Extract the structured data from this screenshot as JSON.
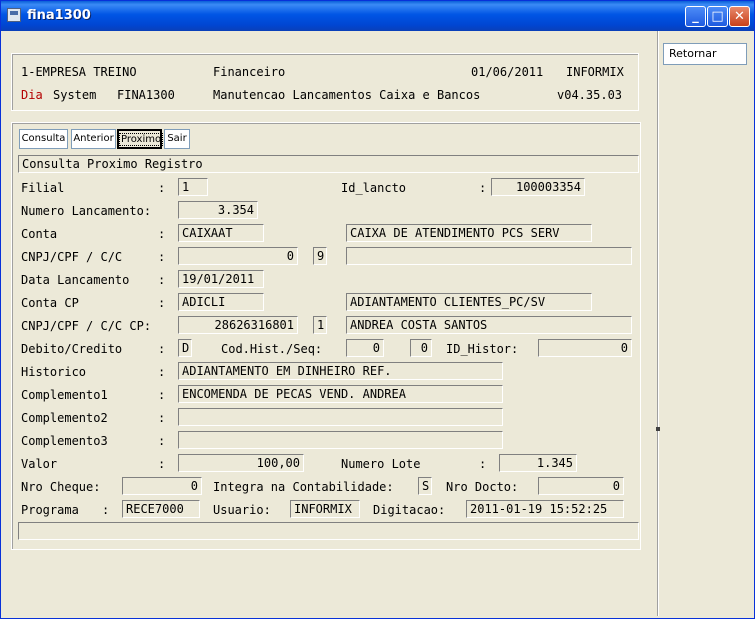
{
  "window": {
    "title": "fina1300"
  },
  "header": {
    "company": "1-EMPRESA TREINO",
    "module": "Financeiro",
    "date": "01/06/2011",
    "user_top": "INFORMIX",
    "dia": "Dia",
    "system_label": "System",
    "program": "FINA1300",
    "function": "Manutencao Lancamentos Caixa e Bancos",
    "version": "v04.35.03"
  },
  "side": {
    "retornar": "Retornar"
  },
  "tabs": [
    {
      "label": "Consulta"
    },
    {
      "label": "Anterior"
    },
    {
      "label": "Proximo"
    },
    {
      "label": "Sair"
    }
  ],
  "status": "Consulta Proximo Registro",
  "labels": {
    "filial": "Filial",
    "id_lancto": "Id_lancto",
    "numero_lancamento": "Numero Lancamento:",
    "conta": "Conta",
    "cnpj": "CNPJ/CPF / C/C",
    "data_lancamento": "Data Lancamento",
    "conta_cp": "Conta CP",
    "cnpj_cp": "CNPJ/CPF / C/C CP:",
    "debito_credito": "Debito/Credito",
    "cod_hist": "Cod.Hist./Seq:",
    "id_histor": "ID_Histor:",
    "historico": "Historico",
    "complemento1": "Complemento1",
    "complemento2": "Complemento2",
    "complemento3": "Complemento3",
    "valor": "Valor",
    "numero_lote": "Numero Lote",
    "nro_cheque": "Nro Cheque:",
    "integra": "Integra na Contabilidade:",
    "nro_docto": "Nro Docto:",
    "programa": "Programa",
    "usuario": "Usuario:",
    "digitacao": "Digitacao:",
    "colon": ":"
  },
  "values": {
    "filial": "1",
    "id_lancto": "100003354",
    "numero_lancamento": "3.354",
    "conta": "CAIXAAT",
    "conta_desc": "CAIXA DE ATENDIMENTO PCS SERV",
    "cnpj": "0",
    "cnpj_dv": "9",
    "cnpj_name": "",
    "data_lancamento": "19/01/2011",
    "conta_cp": "ADICLI",
    "conta_cp_desc": "ADIANTAMENTO CLIENTES_PC/SV",
    "cnpj_cp": "28626316801",
    "cnpj_cp_dv": "1",
    "cnpj_cp_name": "ANDREA COSTA SANTOS",
    "debito_credito": "D",
    "cod_hist": "0",
    "seq": "0",
    "id_histor": "0",
    "historico": "ADIANTAMENTO EM DINHEIRO REF.",
    "complemento1": "ENCOMENDA DE PECAS VEND. ANDREA",
    "complemento2": "",
    "complemento3": "",
    "valor": "100,00",
    "numero_lote": "1.345",
    "nro_cheque": "0",
    "integra": "S",
    "nro_docto": "0",
    "programa": "RECE7000",
    "usuario": "INFORMIX",
    "digitacao": "2011-01-19 15:52:25",
    "footer": ""
  }
}
